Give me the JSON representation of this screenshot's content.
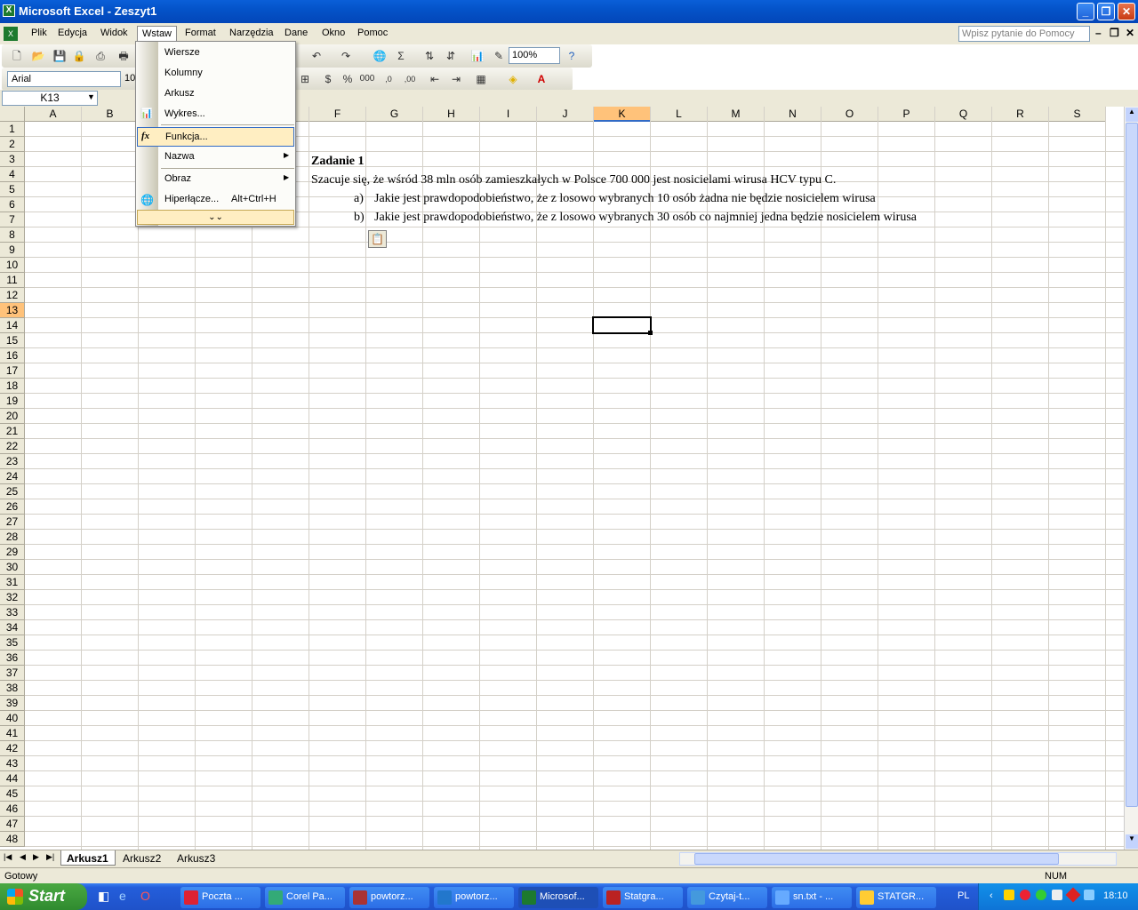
{
  "app": {
    "title": "Microsoft Excel - Zeszyt1"
  },
  "menu": [
    "Plik",
    "Edycja",
    "Widok",
    "Wstaw",
    "Format",
    "Narzędzia",
    "Dane",
    "Okno",
    "Pomoc"
  ],
  "help_placeholder": "Wpisz pytanie do Pomocy",
  "toolbar": {
    "zoom": "100%",
    "font": "Arial",
    "size": "10"
  },
  "namebox": "K13",
  "insert_menu": {
    "items": [
      {
        "label": "Wiersze"
      },
      {
        "label": "Kolumny"
      },
      {
        "label": "Arkusz"
      },
      {
        "label": "Wykres..."
      },
      {
        "label": "Funkcja..."
      },
      {
        "label": "Nazwa"
      },
      {
        "label": "Obraz"
      },
      {
        "label": "Hiperłącze...",
        "shortcut": "Alt+Ctrl+H"
      }
    ]
  },
  "columns": [
    "A",
    "B",
    "C",
    "D",
    "E",
    "F",
    "G",
    "H",
    "I",
    "J",
    "K",
    "L",
    "M",
    "N",
    "O",
    "P",
    "Q",
    "R",
    "S"
  ],
  "selected_column": "K",
  "selected_row": "13",
  "cells": {
    "f3": "Zadanie 1",
    "f4": "Szacuje się, że wśród 38 mln osób zamieszkałych w Polsce 700 000 jest nosicielami wirusa HCV typu C.",
    "g5_marker": "a)",
    "g5": "Jakie jest prawdopodobieństwo, że z losowo wybranych 10 osób żadna nie będzie nosicielem wirusa",
    "g6_marker": "b)",
    "g6": "Jakie jest prawdopodobieństwo, że z losowo wybranych 30 osób co najmniej jedna będzie nosicielem wirusa"
  },
  "sheets": [
    "Arkusz1",
    "Arkusz2",
    "Arkusz3"
  ],
  "status": {
    "left": "Gotowy",
    "num": "NUM"
  },
  "taskbar": {
    "start": "Start",
    "tasks": [
      "Poczta ...",
      "Corel Pa...",
      "powtorz...",
      "powtorz...",
      "Microsof...",
      "Statgra...",
      "Czytaj-t...",
      "sn.txt - ...",
      "STATGR..."
    ],
    "lang": "PL",
    "clock": "18:10"
  }
}
